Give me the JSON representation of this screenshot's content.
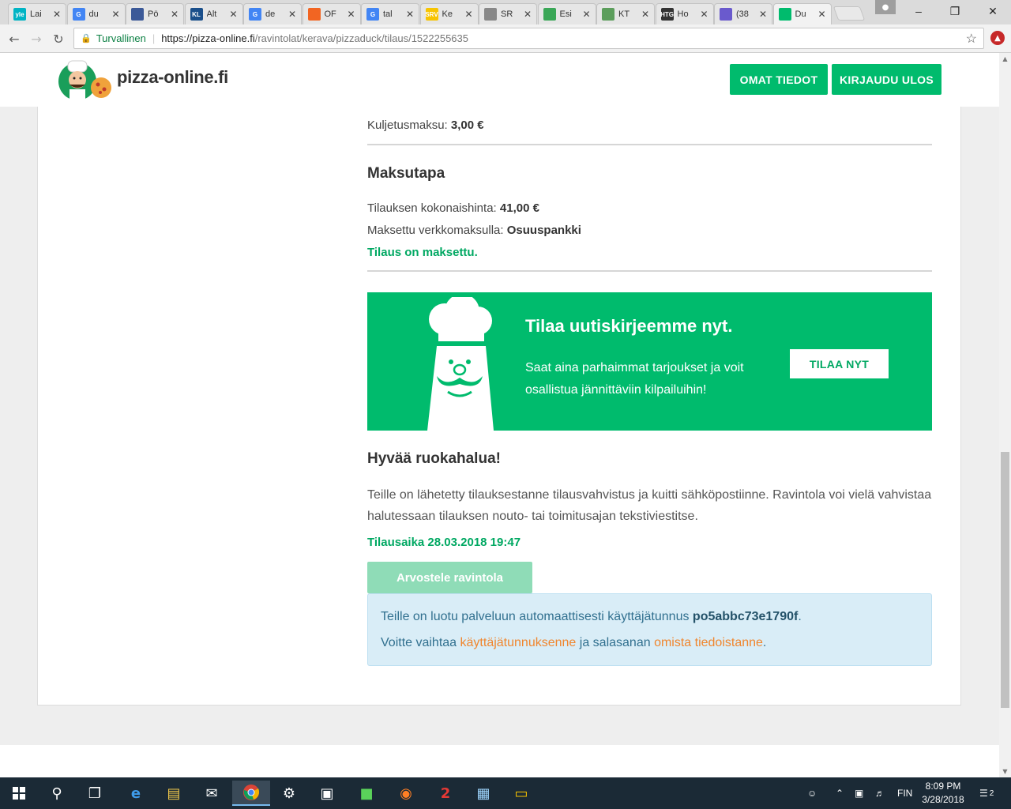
{
  "browser": {
    "tabs": [
      {
        "title": "Lai",
        "favicon": "yle",
        "color": "#00b4c4"
      },
      {
        "title": "du",
        "favicon": "G",
        "color": "#4285f4"
      },
      {
        "title": "Pö",
        "favicon": "",
        "color": "#3b5998"
      },
      {
        "title": "Alt",
        "favicon": "KL",
        "color": "#1a4f8b"
      },
      {
        "title": "de",
        "favicon": "G",
        "color": "#4285f4"
      },
      {
        "title": "OF",
        "favicon": "",
        "color": "#f26522"
      },
      {
        "title": "tal",
        "favicon": "G",
        "color": "#4285f4"
      },
      {
        "title": "Ke",
        "favicon": "SRV",
        "color": "#f7c400"
      },
      {
        "title": "SR",
        "favicon": "",
        "color": "#888888"
      },
      {
        "title": "Esi",
        "favicon": "",
        "color": "#3aa757"
      },
      {
        "title": "KT",
        "favicon": "",
        "color": "#5c9e5c"
      },
      {
        "title": "Ho",
        "favicon": "HTG",
        "color": "#333333"
      },
      {
        "title": "(38",
        "favicon": "",
        "color": "#6a5acd"
      },
      {
        "title": "Du",
        "favicon": "",
        "color": "#00bb6d",
        "active": true
      }
    ],
    "secure_label": "Turvallinen",
    "url_host": "https://pizza-online.fi",
    "url_path": "/ravintolat/kerava/pizzaduck/tilaus/1522255635"
  },
  "site": {
    "logo_text": "pizza-online.fi",
    "btn_profile": "OMAT TIEDOT",
    "btn_logout": "KIRJAUDU ULOS"
  },
  "order": {
    "delivery_label": "Kuljetusmaksu:",
    "delivery_value": "3,00 €",
    "payment_heading": "Maksutapa",
    "total_label": "Tilauksen kokonaishinta:",
    "total_value": "41,00 €",
    "paid_label": "Maksettu verkkomaksulla:",
    "paid_value": "Osuuspankki",
    "paid_status": "Tilaus on maksettu."
  },
  "newsletter": {
    "title": "Tilaa uutiskirjeemme nyt.",
    "body": "Saat aina parhaimmat tarjoukset ja voit osallistua jännittäviin kilpailuihin!",
    "button": "TILAA NYT"
  },
  "thanks": {
    "heading": "Hyvää ruokahalua!",
    "paragraph": "Teille on lähetetty tilauksestanne tilausvahvistus ja kuitti sähköpostiinne. Ravintola voi vielä vahvistaa halutessaan tilauksen nouto- tai toimitusajan tekstiviestitse.",
    "order_time": "Tilausaika 28.03.2018 19:47",
    "review_button": "Arvostele ravintola"
  },
  "account_info": {
    "line1_prefix": "Teille on luotu palveluun automaattisesti käyttäjätunnus",
    "username": "po5abbc73e1790f",
    "line1_suffix": ".",
    "line2_prefix": "Voitte vaihtaa",
    "link_username": "käyttäjätunnuksenne",
    "line2_mid": "ja salasanan",
    "link_profile": "omista tiedoistanne",
    "line2_suffix": "."
  },
  "taskbar": {
    "language": "FIN",
    "time": "8:09 PM",
    "date": "3/28/2018",
    "notifications": "2"
  }
}
